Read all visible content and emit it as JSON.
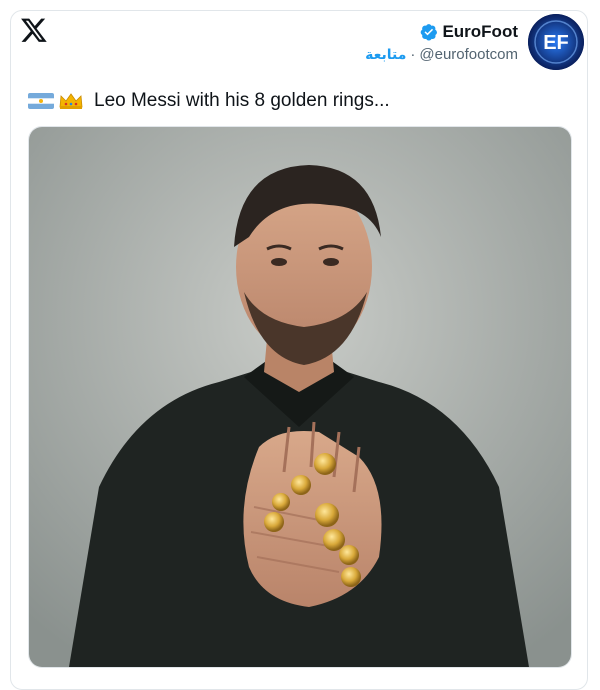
{
  "header": {
    "logo_icon": "x-logo-icon",
    "display_name": "EuroFoot",
    "verified_icon": "verified-badge-icon",
    "follow_label": "متابعة",
    "separator": "·",
    "handle": "@eurofootcom",
    "avatar_text": "EF"
  },
  "tweet": {
    "emojis": [
      "argentina-flag-icon",
      "crown-icon"
    ],
    "text": "Leo Messi with his 8 golden rings..."
  },
  "media": {
    "description_icon": "photo-man-with-golden-rings"
  },
  "colors": {
    "accent": "#1d9bf0",
    "text_primary": "#0f1419",
    "text_secondary": "#536471"
  }
}
